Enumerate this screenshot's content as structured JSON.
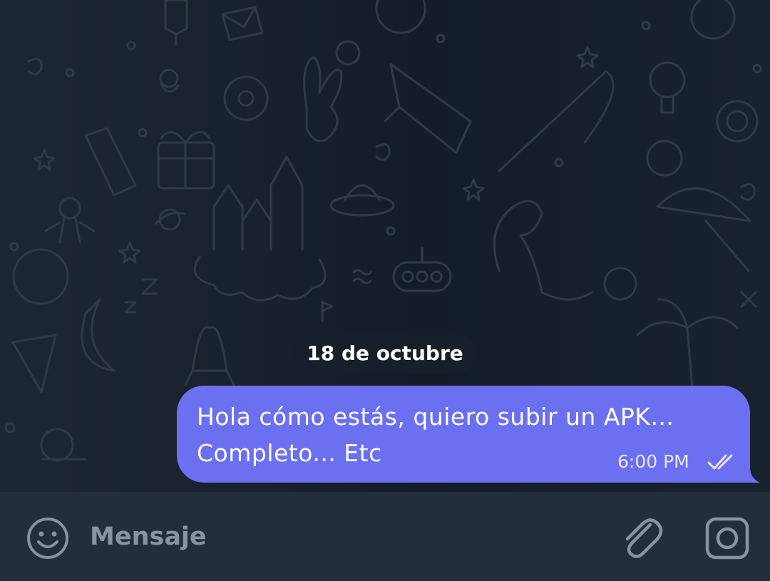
{
  "chat": {
    "date_separator": "18 de octubre",
    "message": {
      "text": "Hola cómo estás, quiero subir un APK...\nCompleto... Etc",
      "time": "6:00 PM",
      "status_icon": "double-check-icon"
    }
  },
  "composer": {
    "placeholder": "Mensaje",
    "value": "",
    "left_icon": "emoji-icon",
    "right_icons": [
      "attach-icon",
      "camera-icon"
    ]
  },
  "colors": {
    "outgoing_bubble": "#6a70f0",
    "chat_background": "#17202b",
    "composer_background": "#232e3a",
    "placeholder": "#8694a2"
  }
}
